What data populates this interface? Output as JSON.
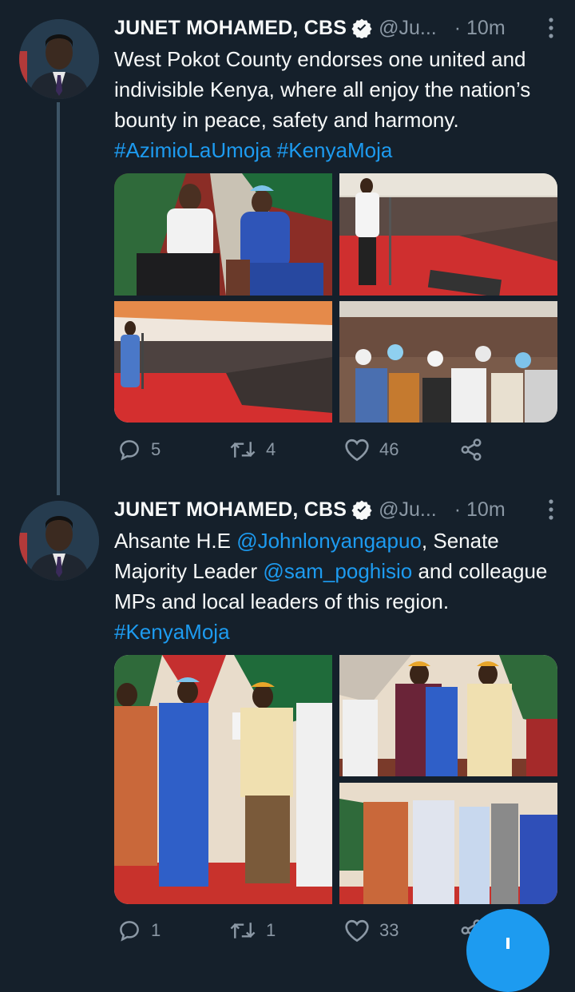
{
  "tweets": [
    {
      "author": "JUNET MOHAMED, CBS",
      "handle": "@Ju...",
      "time": "· 10m",
      "text_parts": [
        "West Pokot County endorses one united and indivisible Kenya, where all enjoy the nation’s bounty in peace, safety and harmony. ",
        "#AzimioLaUmoja",
        " ",
        "#KenyaMoja"
      ],
      "replies": "5",
      "retweets": "4",
      "likes": "46"
    },
    {
      "author": "JUNET MOHAMED, CBS",
      "handle": "@Ju...",
      "time": "· 10m",
      "text_parts": [
        "Ahsante H.E ",
        "@Johnlonyangapuo",
        ", Senate Majority Leader ",
        "@sam_poghisio",
        " and colleague MPs and local leaders of this region. ",
        "#KenyaMoja"
      ],
      "replies": "1",
      "retweets": "1",
      "likes": "33"
    }
  ],
  "icons": {
    "verified": "verified-badge-icon",
    "more": "more-options-icon",
    "reply": "reply-icon",
    "retweet": "retweet-icon",
    "like": "heart-icon",
    "share": "share-icon",
    "compose": "compose-plus-icon"
  },
  "colors": {
    "background": "#15202b",
    "accent": "#1d9bf0",
    "muted": "#8b98a5"
  }
}
